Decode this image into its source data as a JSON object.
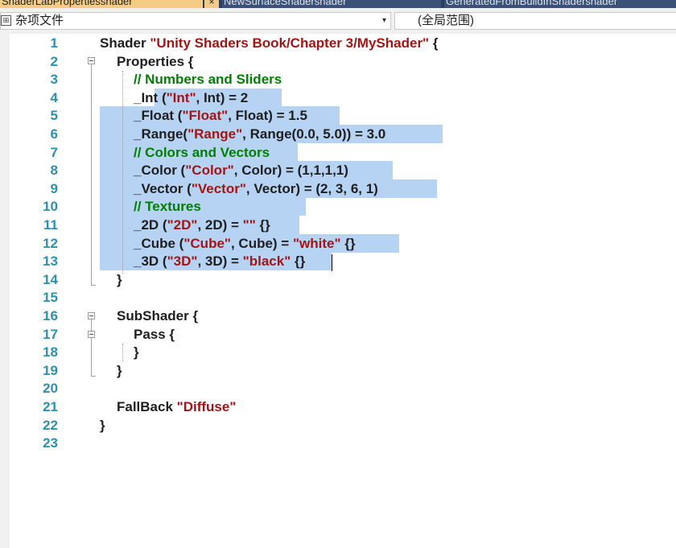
{
  "tabs": [
    {
      "label": "ShaderLabPropertiesshader",
      "active": true,
      "close": "×"
    },
    {
      "label": "NewSurfaceShadershader",
      "active": false
    },
    {
      "label": "GeneratedFromBuildInShadershader",
      "active": false
    }
  ],
  "nav": {
    "file_icon": "misc-files-icon",
    "scope": "杂项文件",
    "dropdown_arrow": "▾",
    "member": "(全局范围)"
  },
  "editor": {
    "lines": [
      {
        "num": "1",
        "parts": [
          {
            "t": "Shader ",
            "c": "kw"
          },
          {
            "t": "\"Unity Shaders Book/Chapter 3/MyShader\"",
            "c": "str"
          },
          {
            "t": " {",
            "c": "kw"
          }
        ]
      },
      {
        "num": "2",
        "parts": [
          {
            "t": "Properties {",
            "c": "kw"
          }
        ]
      },
      {
        "num": "3",
        "parts": [
          {
            "t": "// Numbers and Sliders",
            "c": "cmt"
          }
        ]
      },
      {
        "num": "4",
        "parts": [
          {
            "t": "_Int (",
            "c": "kw"
          },
          {
            "t": "\"Int\"",
            "c": "str"
          },
          {
            "t": ", Int) = 2",
            "c": "kw"
          }
        ]
      },
      {
        "num": "5",
        "parts": [
          {
            "t": "_Float (",
            "c": "kw"
          },
          {
            "t": "\"Float\"",
            "c": "str"
          },
          {
            "t": ", Float) = 1.5",
            "c": "kw"
          }
        ]
      },
      {
        "num": "6",
        "parts": [
          {
            "t": "_Range(",
            "c": "kw"
          },
          {
            "t": "\"Range\"",
            "c": "str"
          },
          {
            "t": ", Range(0.0, 5.0)) = 3.0",
            "c": "kw"
          }
        ]
      },
      {
        "num": "7",
        "parts": [
          {
            "t": "// Colors and Vectors",
            "c": "cmt"
          }
        ]
      },
      {
        "num": "8",
        "parts": [
          {
            "t": "_Color (",
            "c": "kw"
          },
          {
            "t": "\"Color\"",
            "c": "str"
          },
          {
            "t": ", Color) = (1,1,1,1)",
            "c": "kw"
          }
        ]
      },
      {
        "num": "9",
        "parts": [
          {
            "t": "_Vector (",
            "c": "kw"
          },
          {
            "t": "\"Vector\"",
            "c": "str"
          },
          {
            "t": ", Vector) = (2, 3, 6, 1)",
            "c": "kw"
          }
        ]
      },
      {
        "num": "10",
        "parts": [
          {
            "t": "// Textures",
            "c": "cmt"
          }
        ]
      },
      {
        "num": "11",
        "parts": [
          {
            "t": "_2D (",
            "c": "kw"
          },
          {
            "t": "\"2D\"",
            "c": "str"
          },
          {
            "t": ", 2D) = ",
            "c": "kw"
          },
          {
            "t": "\"\"",
            "c": "str"
          },
          {
            "t": " {}",
            "c": "kw"
          }
        ]
      },
      {
        "num": "12",
        "parts": [
          {
            "t": "_Cube (",
            "c": "kw"
          },
          {
            "t": "\"Cube\"",
            "c": "str"
          },
          {
            "t": ", Cube) = ",
            "c": "kw"
          },
          {
            "t": "\"white\"",
            "c": "str"
          },
          {
            "t": " {}",
            "c": "kw"
          }
        ]
      },
      {
        "num": "13",
        "parts": [
          {
            "t": "_3D (",
            "c": "kw"
          },
          {
            "t": "\"3D\"",
            "c": "str"
          },
          {
            "t": ", 3D) = ",
            "c": "kw"
          },
          {
            "t": "\"black\"",
            "c": "str"
          },
          {
            "t": " {}",
            "c": "kw"
          }
        ]
      },
      {
        "num": "14",
        "parts": [
          {
            "t": "}",
            "c": "kw"
          }
        ]
      },
      {
        "num": "15",
        "parts": []
      },
      {
        "num": "16",
        "parts": [
          {
            "t": "SubShader {",
            "c": "kw"
          }
        ]
      },
      {
        "num": "17",
        "parts": [
          {
            "t": "Pass {",
            "c": "kw"
          }
        ]
      },
      {
        "num": "18",
        "parts": [
          {
            "t": "}",
            "c": "kw"
          }
        ]
      },
      {
        "num": "19",
        "parts": [
          {
            "t": "}",
            "c": "kw"
          }
        ]
      },
      {
        "num": "20",
        "parts": []
      },
      {
        "num": "21",
        "parts": [
          {
            "t": "FallBack ",
            "c": "kw"
          },
          {
            "t": "\"Diffuse\"",
            "c": "str"
          }
        ]
      },
      {
        "num": "22",
        "parts": [
          {
            "t": "}",
            "c": "kw"
          }
        ]
      },
      {
        "num": "23",
        "parts": []
      }
    ],
    "colors": {
      "keyword": "#1e1e1e",
      "string": "#a31515",
      "comment": "#008000",
      "line_number": "#2b91af",
      "selection": "#b7d3f4"
    }
  }
}
